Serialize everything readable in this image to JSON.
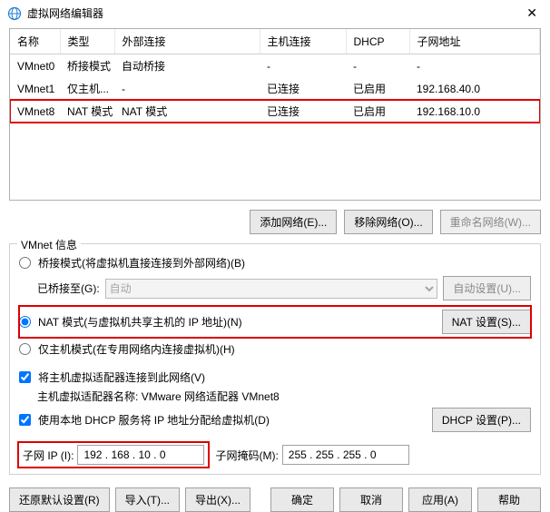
{
  "window": {
    "title": "虚拟网络编辑器"
  },
  "table": {
    "headers": {
      "name": "名称",
      "type": "类型",
      "ext": "外部连接",
      "host": "主机连接",
      "dhcp": "DHCP",
      "subnet": "子网地址"
    },
    "rows": [
      {
        "name": "VMnet0",
        "type": "桥接模式",
        "ext": "自动桥接",
        "host": "-",
        "dhcp": "-",
        "subnet": "-"
      },
      {
        "name": "VMnet1",
        "type": "仅主机...",
        "ext": "-",
        "host": "已连接",
        "dhcp": "已启用",
        "subnet": "192.168.40.0"
      },
      {
        "name": "VMnet8",
        "type": "NAT 模式",
        "ext": "NAT 模式",
        "host": "已连接",
        "dhcp": "已启用",
        "subnet": "192.168.10.0",
        "highlight": true
      }
    ]
  },
  "buttons": {
    "add_net": "添加网络(E)...",
    "remove_net": "移除网络(O)...",
    "rename_net": "重命名网络(W)...",
    "auto_set": "自动设置(U)...",
    "nat_set": "NAT 设置(S)...",
    "dhcp_set": "DHCP 设置(P)...",
    "restore": "还原默认设置(R)",
    "import": "导入(T)...",
    "export": "导出(X)...",
    "ok": "确定",
    "cancel": "取消",
    "apply": "应用(A)",
    "help": "帮助"
  },
  "group": {
    "title": "VMnet 信息",
    "bridge": "桥接模式(将虚拟机直接连接到外部网络)(B)",
    "bridge_to": "已桥接至(G):",
    "bridge_auto": "自动",
    "nat": "NAT 模式(与虚拟机共享主机的 IP 地址)(N)",
    "hostonly": "仅主机模式(在专用网络内连接虚拟机)(H)",
    "host_adapter": "将主机虚拟适配器连接到此网络(V)",
    "host_adapter_name_label": "主机虚拟适配器名称:",
    "host_adapter_name_value": "VMware 网络适配器 VMnet8",
    "use_dhcp": "使用本地 DHCP 服务将 IP 地址分配给虚拟机(D)"
  },
  "ip": {
    "subnet_label": "子网 IP (I):",
    "subnet_value": "192 . 168 . 10 . 0",
    "mask_label": "子网掩码(M):",
    "mask_value": "255 . 255 . 255 . 0"
  }
}
